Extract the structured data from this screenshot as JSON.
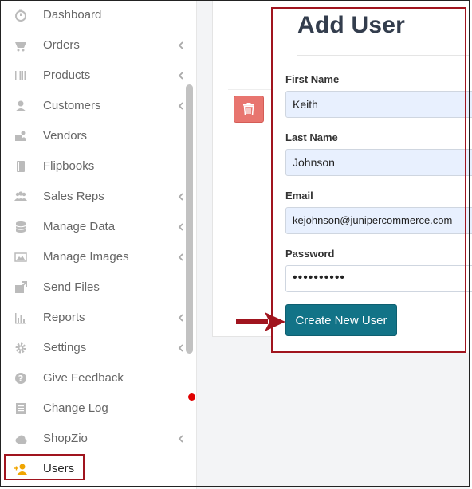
{
  "sidebar": {
    "items": [
      {
        "label": "Dashboard",
        "icon": "dashboard-icon",
        "has_submenu": false
      },
      {
        "label": "Orders",
        "icon": "cart-icon",
        "has_submenu": true
      },
      {
        "label": "Products",
        "icon": "barcode-icon",
        "has_submenu": true
      },
      {
        "label": "Customers",
        "icon": "user-icon",
        "has_submenu": true
      },
      {
        "label": "Vendors",
        "icon": "vendors-icon",
        "has_submenu": false
      },
      {
        "label": "Flipbooks",
        "icon": "book-icon",
        "has_submenu": false
      },
      {
        "label": "Sales Reps",
        "icon": "users-icon",
        "has_submenu": true
      },
      {
        "label": "Manage Data",
        "icon": "database-icon",
        "has_submenu": true
      },
      {
        "label": "Manage Images",
        "icon": "image-icon",
        "has_submenu": true
      },
      {
        "label": "Send Files",
        "icon": "send-files-icon",
        "has_submenu": false
      },
      {
        "label": "Reports",
        "icon": "bar-chart-icon",
        "has_submenu": true
      },
      {
        "label": "Settings",
        "icon": "gear-icon",
        "has_submenu": true
      },
      {
        "label": "Give Feedback",
        "icon": "question-icon",
        "has_submenu": false
      },
      {
        "label": "Change Log",
        "icon": "document-icon",
        "has_submenu": false
      },
      {
        "label": "ShopZio",
        "icon": "cloud-icon",
        "has_submenu": true
      },
      {
        "label": "Users",
        "icon": "add-user-icon",
        "has_submenu": false,
        "active": true
      }
    ]
  },
  "modal": {
    "title": "Add User",
    "fields": {
      "first_name": {
        "label": "First Name",
        "value": "Keith"
      },
      "last_name": {
        "label": "Last Name",
        "value": "Johnson"
      },
      "email": {
        "label": "Email",
        "value": "kejohnson@junipercommerce.com"
      },
      "password": {
        "label": "Password",
        "value": "••••••••••"
      }
    },
    "submit_label": "Create New User"
  },
  "colors": {
    "accent": "#127387",
    "highlight": "#a0141e",
    "delete": "#e8756f",
    "active_icon": "#f0a500"
  }
}
